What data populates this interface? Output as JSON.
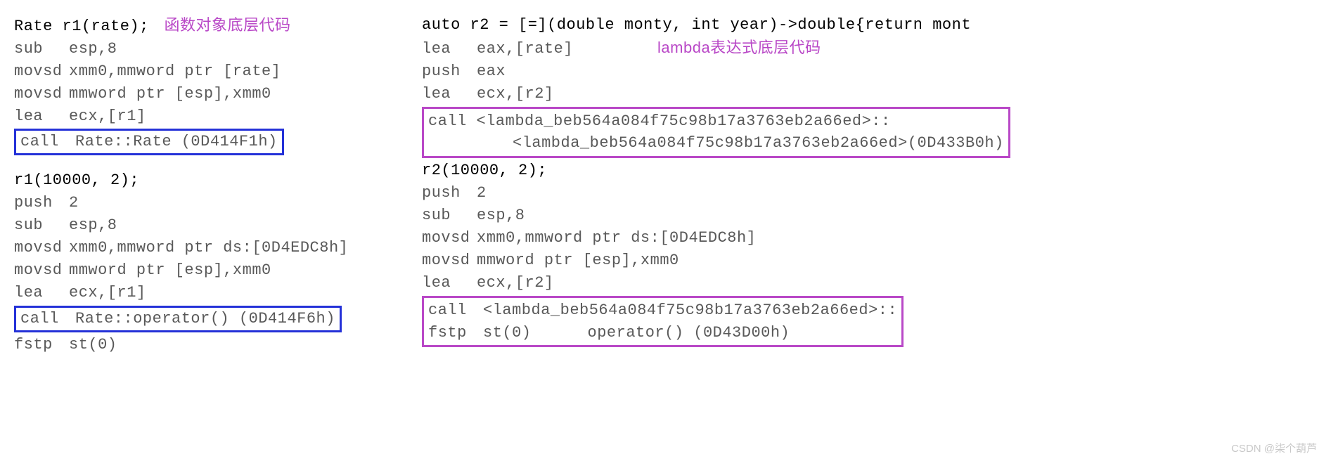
{
  "left": {
    "src1": "Rate r1(rate);",
    "comment": "函数对象底层代码",
    "asm1": [
      {
        "op": "sub",
        "args": "esp,8"
      },
      {
        "op": "movsd",
        "args": "xmm0,mmword ptr [rate]"
      },
      {
        "op": "movsd",
        "args": "mmword ptr [esp],xmm0"
      },
      {
        "op": "lea",
        "args": "ecx,[r1]"
      }
    ],
    "call1": {
      "op": "call",
      "args": "Rate::Rate (0D414F1h)"
    },
    "src2": "r1(10000, 2);",
    "asm2": [
      {
        "op": "push",
        "args": "2"
      },
      {
        "op": "sub",
        "args": "esp,8"
      },
      {
        "op": "movsd",
        "args": "xmm0,mmword ptr ds:[0D4EDC8h]"
      },
      {
        "op": "movsd",
        "args": "mmword ptr [esp],xmm0"
      },
      {
        "op": "lea",
        "args": "ecx,[r1]"
      }
    ],
    "call2": {
      "op": "call",
      "args": "Rate::operator() (0D414F6h)"
    },
    "asm3": [
      {
        "op": "fstp",
        "args": "st(0)"
      }
    ]
  },
  "right": {
    "src1": "auto r2 = [=](double monty, int year)->double{return mont",
    "comment": "lambda表达式底层代码",
    "asm1": [
      {
        "op": "lea",
        "args": "eax,[rate]"
      },
      {
        "op": "push",
        "args": "eax"
      },
      {
        "op": "lea",
        "args": "ecx,[r2]"
      }
    ],
    "call1_line1": "call  <lambda_beb564a084f75c98b17a3763eb2a66ed>::",
    "call1_line2": "<lambda_beb564a084f75c98b17a3763eb2a66ed>(0D433B0h)",
    "src2": "r2(10000, 2);",
    "asm2": [
      {
        "op": "push",
        "args": "2"
      },
      {
        "op": "sub",
        "args": "esp,8"
      },
      {
        "op": "movsd",
        "args": "xmm0,mmword ptr ds:[0D4EDC8h]"
      },
      {
        "op": "movsd",
        "args": "mmword ptr [esp],xmm0"
      },
      {
        "op": "lea",
        "args": "ecx,[r2]"
      }
    ],
    "call2_line1_op": "call",
    "call2_line1_args": "<lambda_beb564a084f75c98b17a3763eb2a66ed>::",
    "call2_line2_op": "fstp",
    "call2_line2_args": "st(0)",
    "call2_line2_tail": "operator() (0D43D00h)"
  },
  "watermark": "CSDN @柒个葫芦"
}
